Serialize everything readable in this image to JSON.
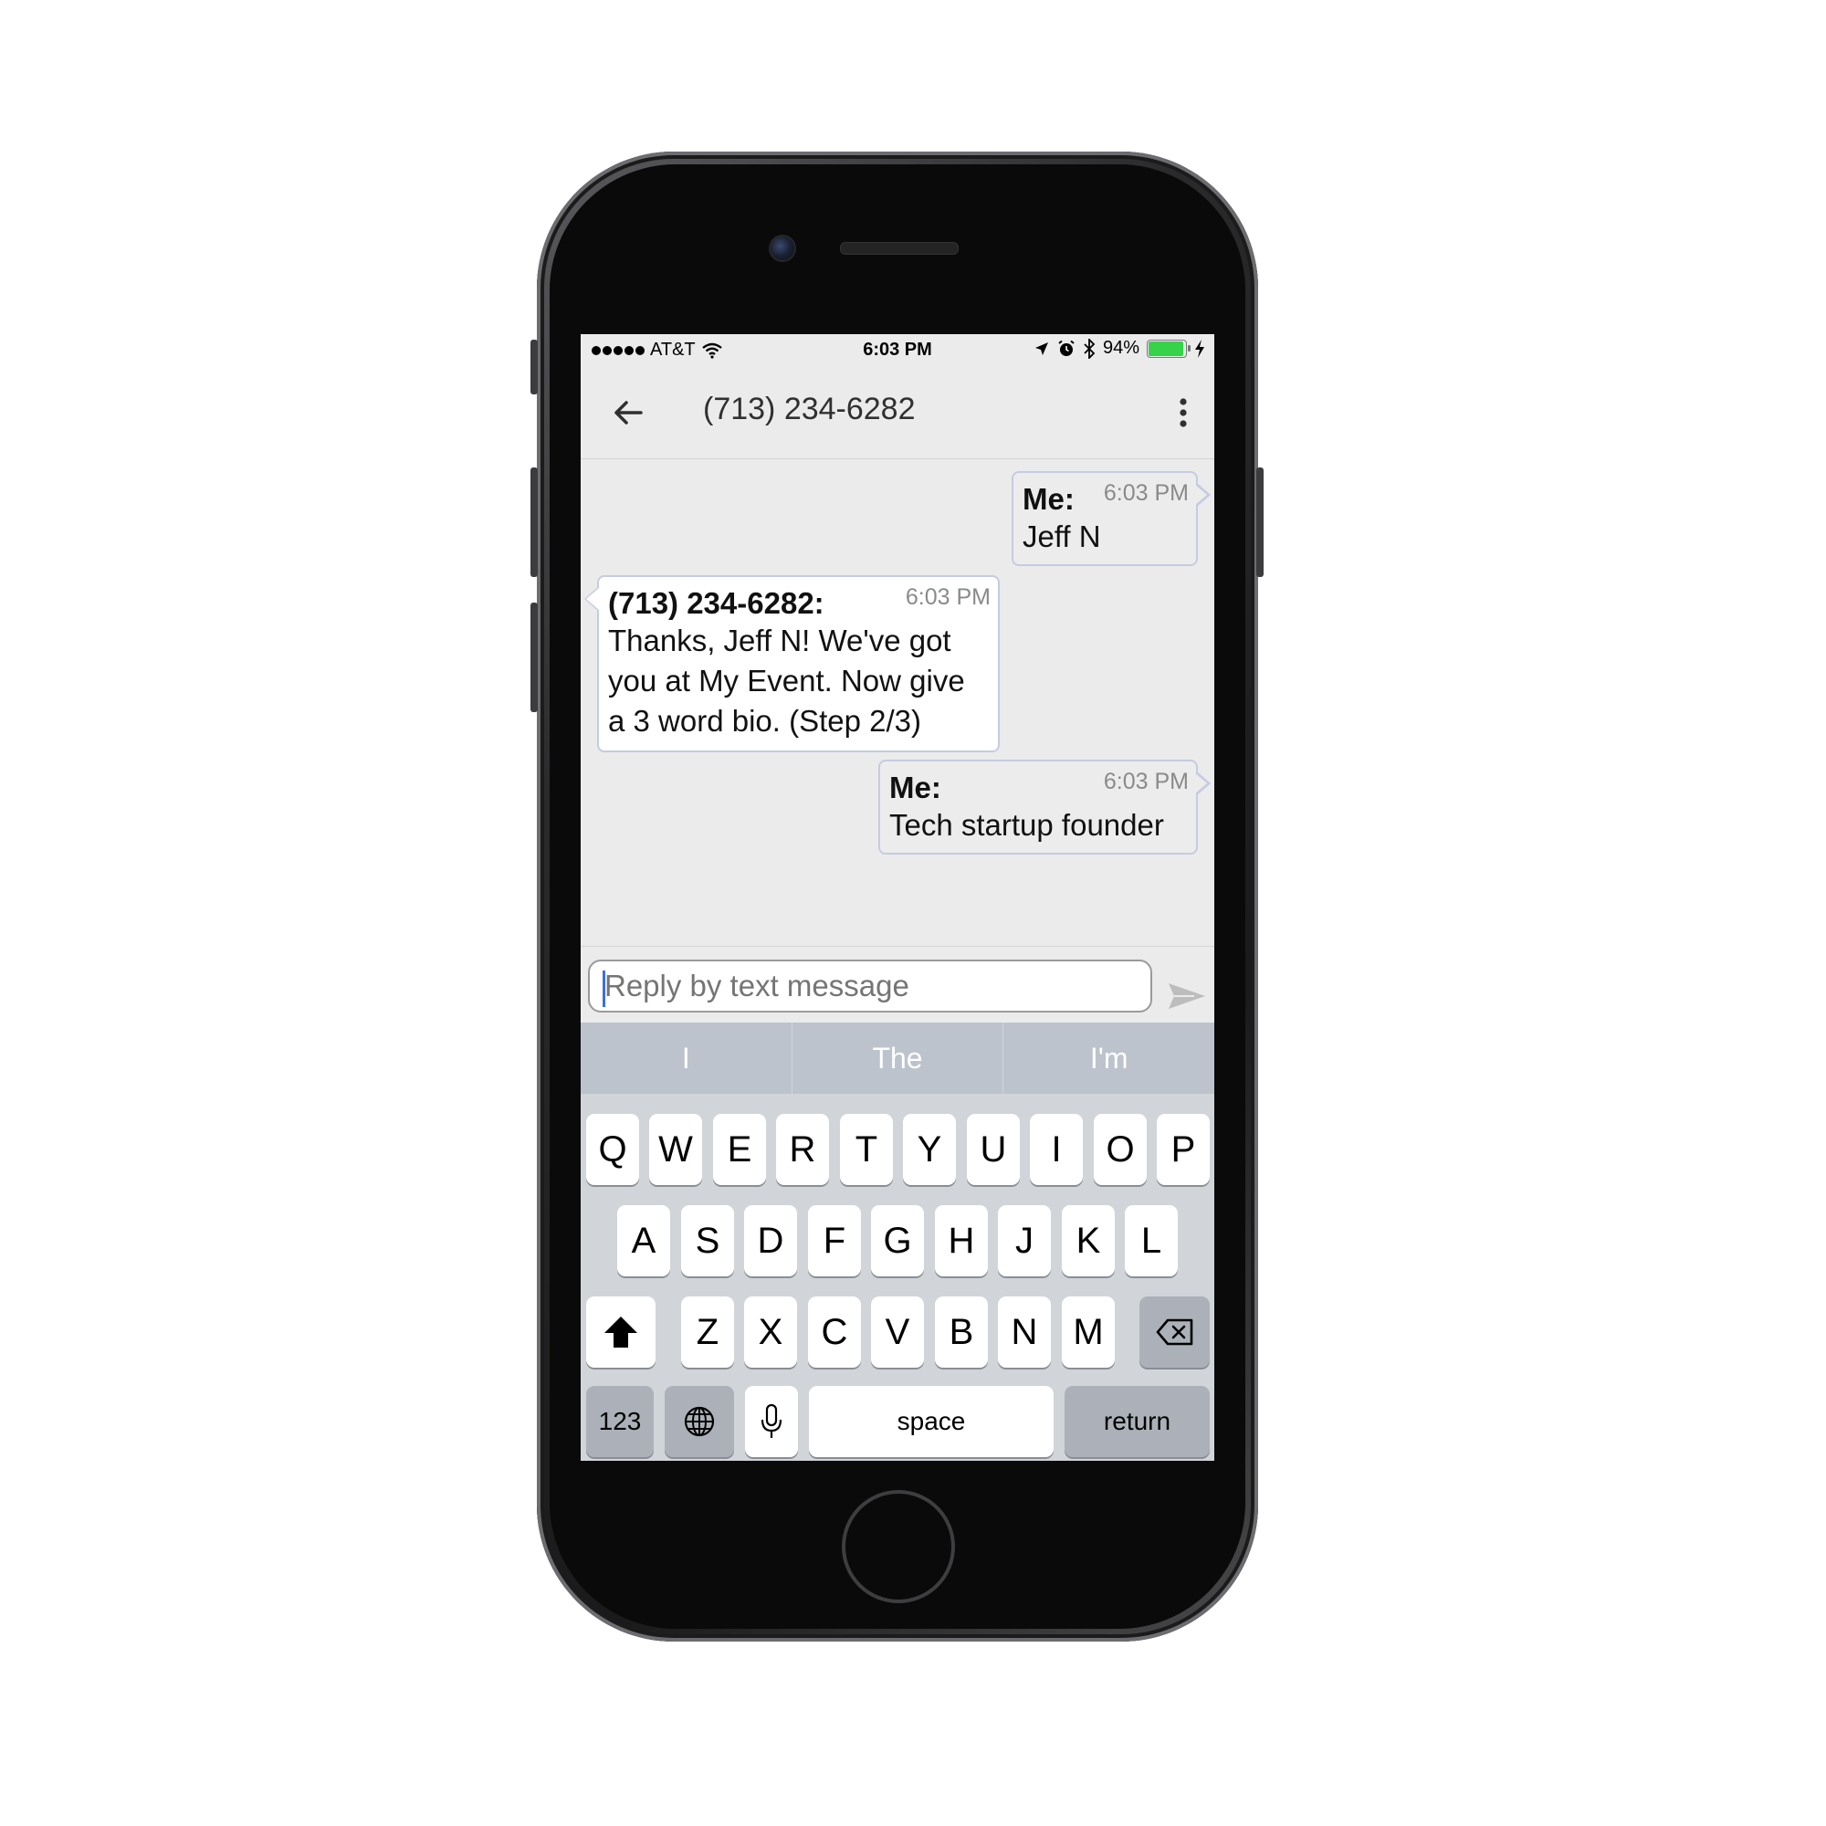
{
  "status_bar": {
    "carrier": "AT&T",
    "time": "6:03 PM",
    "battery": "94%",
    "battery_level": 0.94,
    "colors": {
      "battery_fill": "#35d24a"
    }
  },
  "app_bar": {
    "title": "(713) 234-6282",
    "back_icon": "arrow-left-icon",
    "menu_icon": "more-vert-icon"
  },
  "messages": [
    {
      "sender": "Me:",
      "time": "6:03 PM",
      "lines": [
        "Jeff N"
      ],
      "direction": "outgoing"
    },
    {
      "sender": "(713) 234-6282:",
      "time": "6:03 PM",
      "lines": [
        "Thanks, Jeff N! We've got",
        "you at My Event. Now give",
        "a 3 word bio. (Step 2/3)"
      ],
      "direction": "incoming"
    },
    {
      "sender": "Me:",
      "time": "6:03 PM",
      "lines": [
        "Tech startup founder"
      ],
      "direction": "outgoing"
    }
  ],
  "composer": {
    "placeholder": "Reply by text message",
    "send_icon": "send-icon"
  },
  "keyboard": {
    "suggestions": [
      "I",
      "The",
      "I'm"
    ],
    "row1": [
      "Q",
      "W",
      "E",
      "R",
      "T",
      "Y",
      "U",
      "I",
      "O",
      "P"
    ],
    "row2": [
      "A",
      "S",
      "D",
      "F",
      "G",
      "H",
      "J",
      "K",
      "L"
    ],
    "row3": [
      "Z",
      "X",
      "C",
      "V",
      "B",
      "N",
      "M"
    ],
    "numbers_label": "123",
    "space_label": "space",
    "return_label": "return"
  },
  "colors": {
    "bubble_border": "#c5cbe2",
    "screen_bg": "#ebebeb",
    "suggestion_bar": "#bcc3cc"
  }
}
